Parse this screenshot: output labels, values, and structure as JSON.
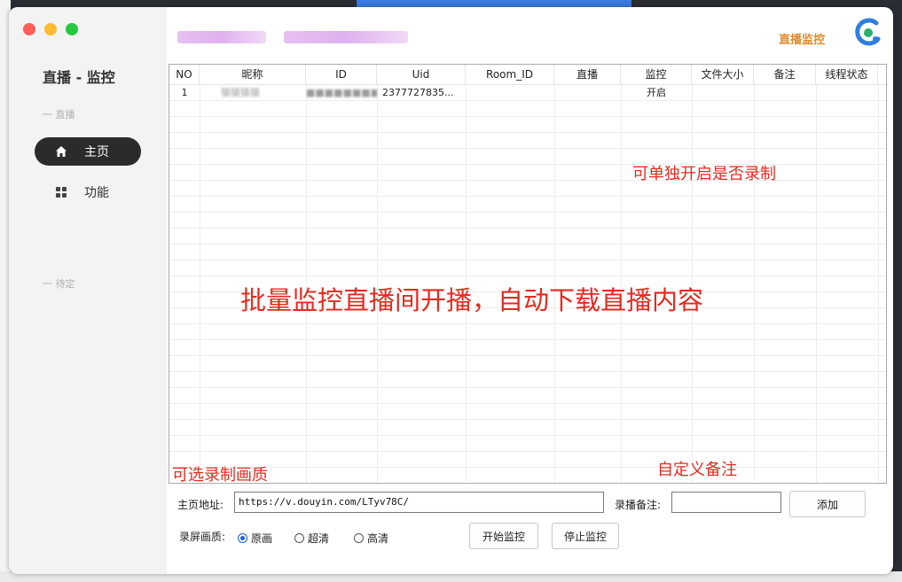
{
  "window": {
    "app_title": "直播 - 监控",
    "header_link": "直播监控",
    "colors": {
      "accent": "#e08a2c",
      "nav_active": "#2b2b2b",
      "annotation": "#e52a1f",
      "radio": "#1a5fd0"
    }
  },
  "sidebar": {
    "section_live": "一 直播",
    "section_pending": "一 待定",
    "items": [
      {
        "label": "主页",
        "icon": "home-icon",
        "active": true
      },
      {
        "label": "功能",
        "icon": "grid-icon",
        "active": false
      }
    ]
  },
  "table": {
    "columns": [
      "NO",
      "昵称",
      "ID",
      "Uid",
      "Room_ID",
      "直播",
      "监控",
      "文件大小",
      "备注",
      "线程状态"
    ],
    "rows": [
      {
        "no": "1",
        "nickname": "猿猿猿猿",
        "id": "■■■■■■■■■■",
        "uid": "2377727835...",
        "room_id": "",
        "live": "",
        "monitor": "开启",
        "size": "",
        "note": "",
        "status": ""
      }
    ]
  },
  "annotations": {
    "record_toggle": "可单独开启是否录制",
    "main": "批量监控直播间开播，自动下载直播内容",
    "quality": "可选录制画质",
    "note": "自定义备注"
  },
  "form": {
    "url_label": "主页地址:",
    "url_value": "https://v.douyin.com/LTyv78C/",
    "note_label": "录播备注:",
    "note_value": "",
    "add_button": "添加",
    "quality_label": "录屏画质:",
    "quality_options": [
      "原画",
      "超清",
      "高清"
    ],
    "quality_selected": "原画",
    "start_button": "开始监控",
    "stop_button": "停止监控"
  }
}
